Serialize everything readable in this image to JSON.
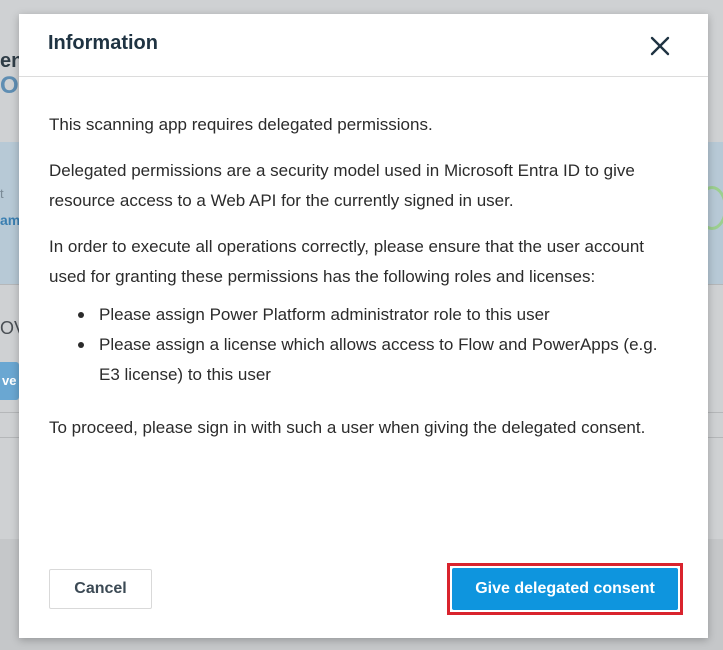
{
  "background": {
    "fragment_title": "en",
    "fragment_logo": "O",
    "fragment_label": "t",
    "fragment_link": "am",
    "fragment_heading": "OV",
    "fragment_button": "ve"
  },
  "dialog": {
    "title": "Information",
    "close_icon": "close-icon",
    "paragraphs": [
      "This scanning app requires delegated permissions.",
      "Delegated permissions are a security model used in Microsoft Entra ID to give resource access to a Web API for the currently signed in user.",
      "In order to execute all operations correctly, please ensure that the user account used for granting these permissions has the following roles and licenses:"
    ],
    "requirements": [
      "Please assign Power Platform administrator role to this user",
      "Please assign a license which allows access to Flow and PowerApps (e.g. E3 license) to this user"
    ],
    "closing_text": "To proceed, please sign in with such a user when giving the delegated consent.",
    "buttons": {
      "cancel": "Cancel",
      "consent": "Give delegated consent"
    }
  },
  "colors": {
    "primary": "#0e95de",
    "highlight": "#d9232d",
    "title": "#1f3342"
  }
}
